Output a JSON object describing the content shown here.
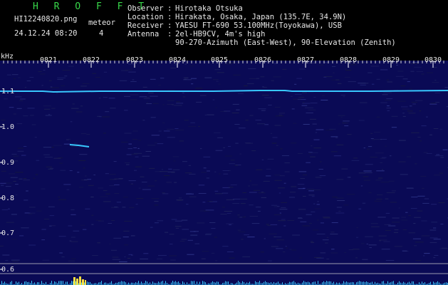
{
  "header": {
    "brand": "H R O F F T",
    "filename": "HI12240820.png",
    "datetime": "24.12.24 08:20",
    "meteor_label": "meteor",
    "meteor_count": "4",
    "observer_label": "Observer",
    "observer": "Hirotaka Otsuka",
    "location_label": "Location",
    "location": "Hirakata, Osaka, Japan (135.7E, 34.9N)",
    "receiver_label": "Receiver",
    "receiver": "YAESU FT-690 53.100MHz(Toyokawa), USB",
    "antenna_label": "Antenna",
    "antenna_line1": "2el-HB9CV, 4m's high",
    "antenna_line2": "90-270-Azimuth (East-West), 90-Elevation (Zenith)"
  },
  "axes": {
    "unit": "kHz",
    "y_ticks": [
      "1.1",
      "1.0",
      "0.9",
      "0.8",
      "0.7",
      "0.6"
    ],
    "x_ticks": [
      "0821",
      "0822",
      "0823",
      "0824",
      "0825",
      "0826",
      "0827",
      "0828",
      "0829",
      "0830"
    ]
  },
  "colors": {
    "background": "#000000",
    "spectrogram_bg": "#0a0a55",
    "carrier": "#38c8ff",
    "brand": "#38d84a",
    "meteor_echo": "#ffe040",
    "text": "#e8e8e8"
  }
}
